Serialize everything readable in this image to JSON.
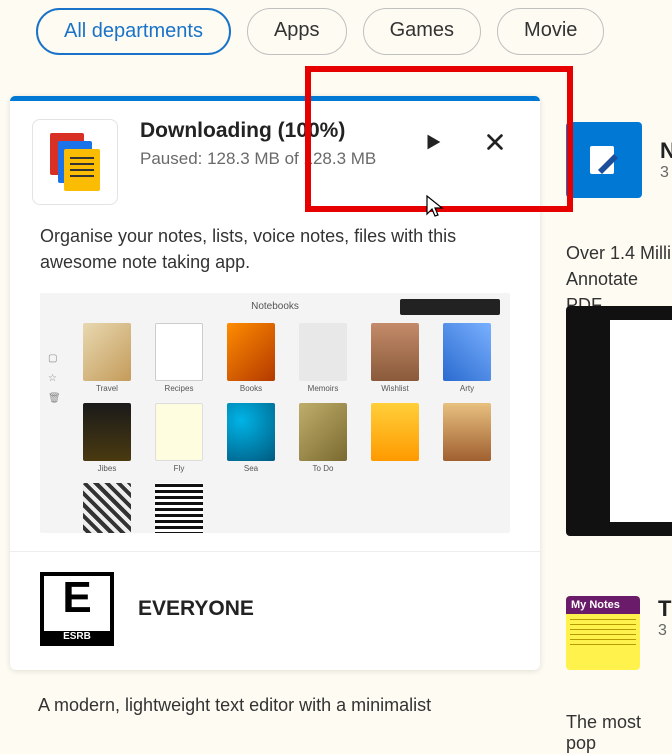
{
  "filters": {
    "active": "All departments",
    "apps": "Apps",
    "games": "Games",
    "movies": "Movie"
  },
  "download": {
    "title": "Downloading (100%)",
    "status": "Paused: 128.3 MB of 128.3 MB"
  },
  "card": {
    "description": "Organise your notes, lists, voice notes, files with this awesome note taking app.",
    "screenshot": {
      "title": "Notebooks",
      "thumbs": [
        {
          "label": "Travel",
          "c": "cov-a"
        },
        {
          "label": "Recipes",
          "c": "cov-b"
        },
        {
          "label": "Books",
          "c": "cov-c"
        },
        {
          "label": "Memoirs",
          "c": "cov-d"
        },
        {
          "label": "Wishlist",
          "c": "cov-e"
        },
        {
          "label": "Arty",
          "c": "cov-f"
        },
        {
          "label": "Jibes",
          "c": "cov-g"
        },
        {
          "label": "Fly",
          "c": "cov-h"
        },
        {
          "label": "Sea",
          "c": "cov-i"
        },
        {
          "label": "To Do",
          "c": "cov-j"
        },
        {
          "label": "",
          "c": "cov-k"
        },
        {
          "label": "",
          "c": "cov-l"
        },
        {
          "label": "",
          "c": "cov-m"
        },
        {
          "label": "",
          "c": "cov-n"
        }
      ]
    },
    "rating": {
      "code": "E",
      "org": "ESRB",
      "label": "EVERYONE"
    }
  },
  "card2": {
    "description": "A modern, lightweight text editor with a minimalist"
  },
  "right1": {
    "title": "N",
    "sub": "3",
    "desc1": "Over 1.4 Milli",
    "desc2": "Annotate PDF"
  },
  "right2": {
    "iconTitle": "My Notes",
    "title": "T",
    "sub": "3",
    "desc": "The most pop"
  }
}
